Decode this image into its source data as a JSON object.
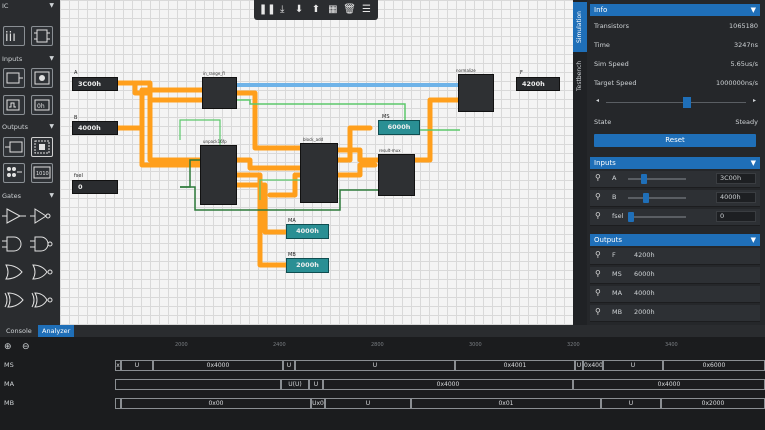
{
  "toolbar": {
    "icons": [
      "pause-icon",
      "step-icon",
      "download-icon",
      "upload-icon",
      "grid-icon",
      "trash-icon",
      "menu-icon"
    ]
  },
  "palette": {
    "sections": [
      {
        "label": "IC"
      },
      {
        "label": "Inputs"
      },
      {
        "label": "Outputs"
      },
      {
        "label": "Gates"
      }
    ]
  },
  "circuit": {
    "inputs": [
      {
        "name": "A",
        "value": "3C00h"
      },
      {
        "name": "B",
        "value": "4000h"
      },
      {
        "name": "fsel",
        "value": "0"
      }
    ],
    "outputs": [
      {
        "name": "F",
        "value": "4200h"
      },
      {
        "name": "MS",
        "value": "6000h"
      },
      {
        "name": "MA",
        "value": "4000h"
      },
      {
        "name": "MB",
        "value": "2000h"
      }
    ],
    "chips": [
      {
        "title": "in_range_fl"
      },
      {
        "title": "unpack16fp"
      },
      {
        "title": "block_add"
      },
      {
        "title": "result-mux"
      },
      {
        "title": "normalize"
      }
    ]
  },
  "vtabs": [
    "Simulation",
    "Testbench"
  ],
  "info": {
    "header": "Info",
    "rows": [
      {
        "k": "Transistors",
        "v": "1065180"
      },
      {
        "k": "Time",
        "v": "3247ns"
      },
      {
        "k": "Sim Speed",
        "v": "5.65us/s"
      },
      {
        "k": "Target Speed",
        "v": "1000000ns/s"
      }
    ],
    "state_k": "State",
    "state_v": "Steady",
    "reset": "Reset",
    "speed_level": 0.55
  },
  "inputs_panel": {
    "header": "Inputs",
    "rows": [
      {
        "k": "A",
        "v": "3C00h",
        "level": 0.25
      },
      {
        "k": "B",
        "v": "4000h",
        "level": 0.28
      },
      {
        "k": "fsel",
        "v": "0",
        "level": 0.0
      }
    ]
  },
  "outputs_panel": {
    "header": "Outputs",
    "rows": [
      {
        "k": "F",
        "v": "4200h"
      },
      {
        "k": "MS",
        "v": "6000h"
      },
      {
        "k": "MA",
        "v": "4000h"
      },
      {
        "k": "MB",
        "v": "2000h"
      }
    ]
  },
  "bottom_tabs": {
    "console": "Console",
    "analyzer": "Analyzer"
  },
  "analyzer": {
    "ticks": [
      "2000",
      "2400",
      "2800",
      "3000",
      "3200",
      "3400"
    ],
    "signals": [
      {
        "name": "MS",
        "segments": [
          {
            "t": "x",
            "w": 6
          },
          {
            "t": "U",
            "w": 32
          },
          {
            "t": "0x4000",
            "w": 130
          },
          {
            "t": "U",
            "w": 12
          },
          {
            "t": "U",
            "w": 160
          },
          {
            "t": "0x4001",
            "w": 120
          },
          {
            "t": "U",
            "w": 8
          },
          {
            "t": "0x400",
            "w": 20
          },
          {
            "t": "U",
            "w": 60
          },
          {
            "t": "0x6000",
            "w": 102
          }
        ]
      },
      {
        "name": "MA",
        "segments": [
          {
            "t": "",
            "w": 166
          },
          {
            "t": "U(U)",
            "w": 28
          },
          {
            "t": "U",
            "w": 14
          },
          {
            "t": "0x4000",
            "w": 250
          },
          {
            "t": "0x4000",
            "w": 192
          }
        ]
      },
      {
        "name": "MB",
        "segments": [
          {
            "t": "",
            "w": 6
          },
          {
            "t": "0x00",
            "w": 190
          },
          {
            "t": "Ux0",
            "w": 14
          },
          {
            "t": "U",
            "w": 86
          },
          {
            "t": "0x01",
            "w": 190
          },
          {
            "t": "U",
            "w": 60
          },
          {
            "t": "0x2000",
            "w": 104
          }
        ]
      }
    ]
  },
  "colors": {
    "accent": "#1f6fb8",
    "bus": "#ff9f1c",
    "teal": "#2a8f94",
    "wire_green": "#5cc86b",
    "wire_blue": "#3b8fd6"
  }
}
